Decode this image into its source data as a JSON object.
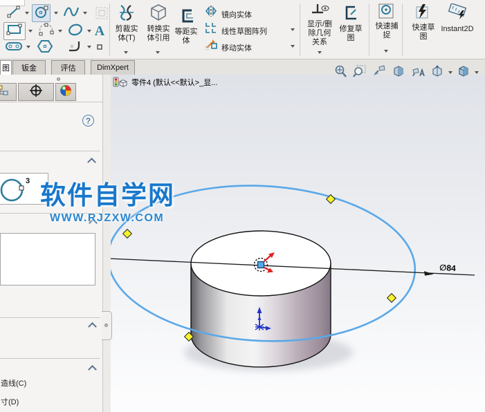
{
  "ribbon": {
    "trim_l1": "剪裁实",
    "trim_l2": "体(T)",
    "convert_l1": "转换实",
    "convert_l2": "体引用",
    "offset_l1": "等距实",
    "offset_l2": "体",
    "mirror_label": "镜向实体",
    "linear_pattern_label": "线性草图阵列",
    "move_label": "移动实体",
    "relations_l1": "显示/删",
    "relations_l2": "除几何",
    "relations_l3": "关系",
    "repair_l1": "修复草",
    "repair_l2": "图",
    "snaps_l1": "快速捕",
    "snaps_l2": "捉",
    "rapid_l1": "快速草",
    "rapid_l2": "图",
    "instant2d_label": "Instant2D"
  },
  "tabs": {
    "t0": "图",
    "t1": "钣金",
    "t2": "评估",
    "t3": "DimXpert"
  },
  "feature_tree": {
    "part_name": "零件4 (默认<<默认>_显..."
  },
  "panel": {
    "help_glyph": "?",
    "circle_type_badge": "3",
    "construction_label": "造线(C)",
    "dimension_label": "寸(D)"
  },
  "watermark": {
    "title": "软件自学网",
    "url": "WWW.RJZXW.COM"
  },
  "scene": {
    "dimension_value": "∅84"
  }
}
